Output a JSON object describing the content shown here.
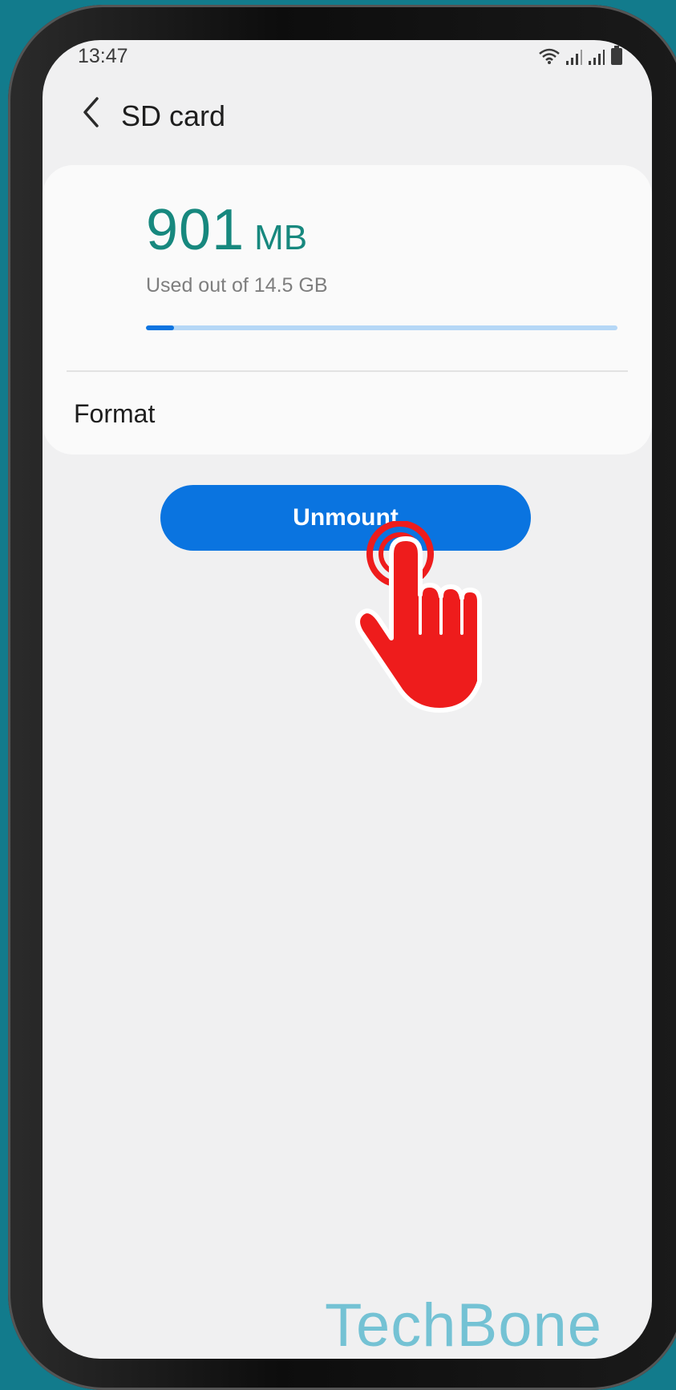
{
  "status_bar": {
    "time": "13:47",
    "icons": [
      "wifi-icon",
      "signal-icon",
      "signal-icon",
      "battery-icon"
    ]
  },
  "header": {
    "title": "SD card",
    "back_icon": "chevron-left-icon"
  },
  "storage": {
    "used_value": "901",
    "used_unit": "MB",
    "caption": "Used out of 14.5 GB",
    "used_fraction": 0.06
  },
  "menu": {
    "format_label": "Format"
  },
  "actions": {
    "unmount_label": "Unmount"
  },
  "overlay": {
    "tap_indicator_icon": "tap-hand-icon",
    "watermark": "TechBone"
  },
  "colors": {
    "accent_blue": "#0a74e0",
    "used_green": "#17887e",
    "tap_red": "#ee1c1c",
    "watermark": "#74c2d4"
  }
}
